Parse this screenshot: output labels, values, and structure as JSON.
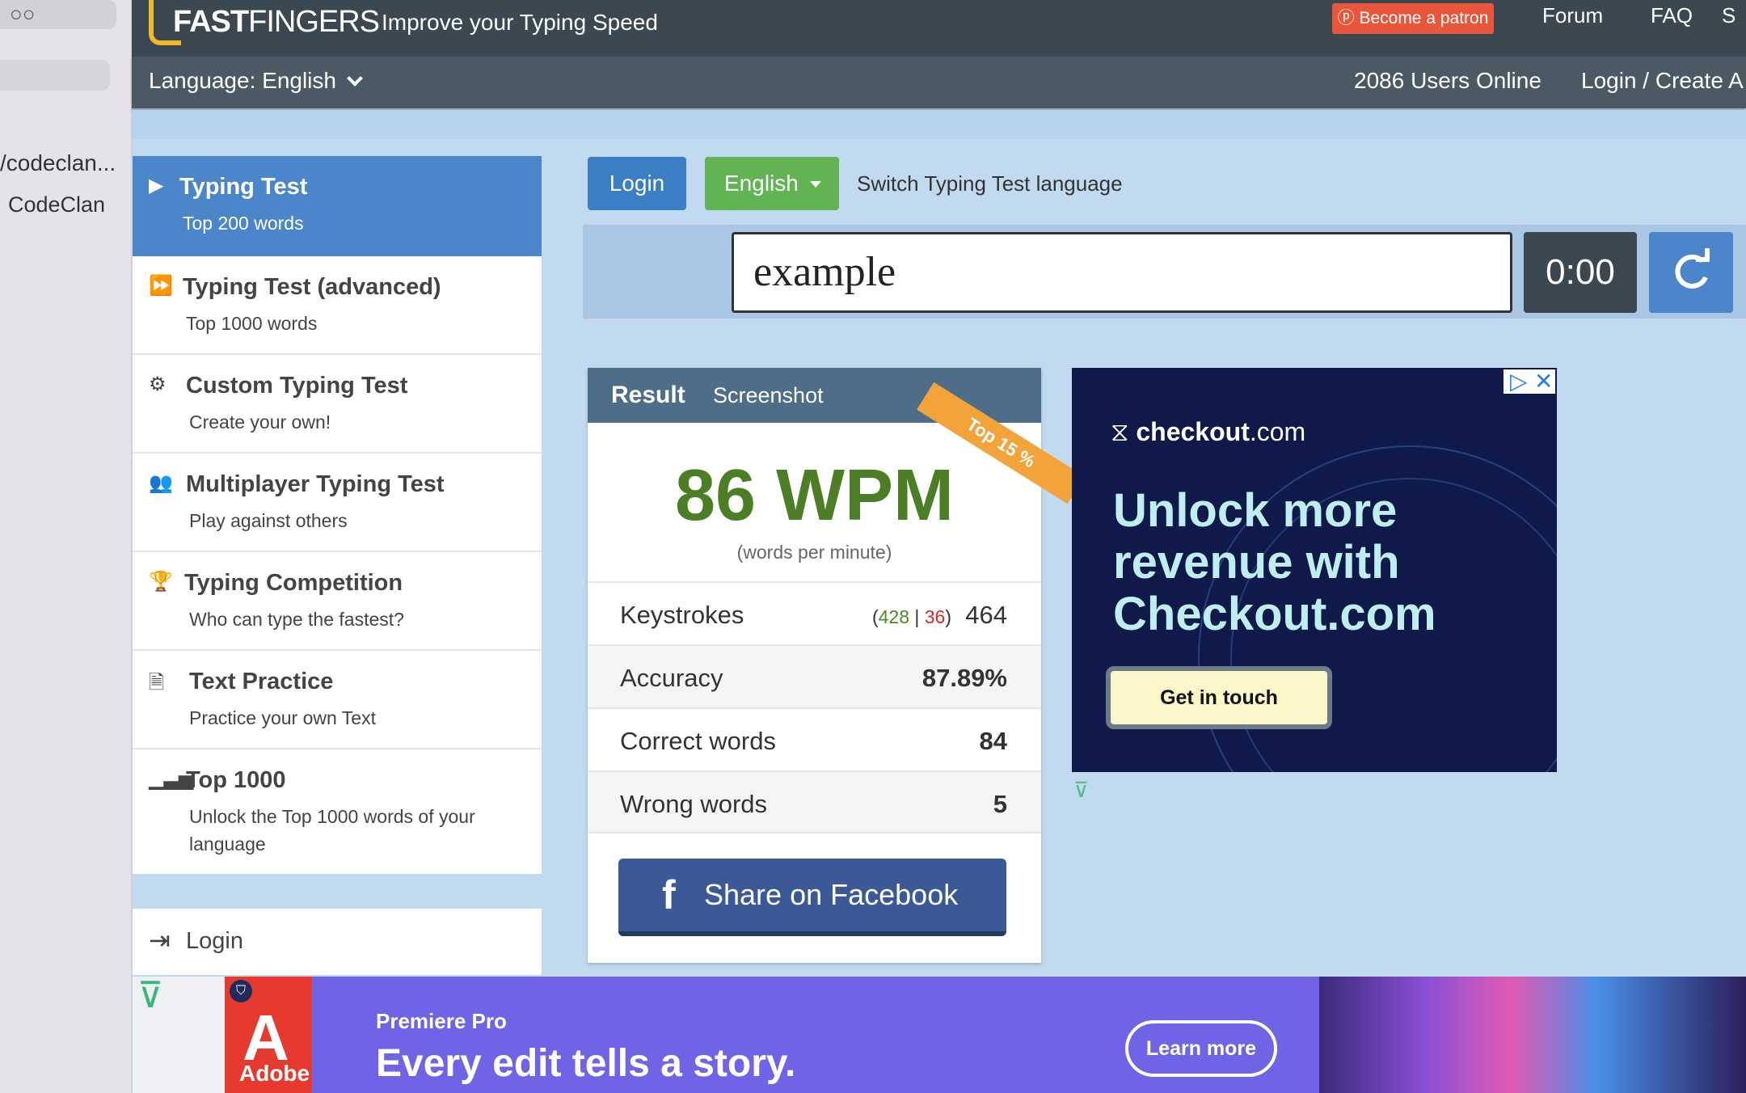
{
  "browser_sidebar": {
    "url_fragment": "/codeclan...",
    "tab_title": "CodeClan"
  },
  "header": {
    "logo_prefix": "FAST",
    "logo_suffix": "FINGERS",
    "tagline": "Improve your Typing Speed",
    "patron_label": "Become a patron",
    "nav": {
      "forum": "Forum",
      "faq": "FAQ",
      "cut": "S"
    }
  },
  "subbar": {
    "language_label": "Language: English",
    "users_online": "2086 Users Online",
    "login_create": "Login / Create A"
  },
  "menu": [
    {
      "title": "Typing Test",
      "sub": "Top 200 words",
      "icon": "play-icon"
    },
    {
      "title": "Typing Test (advanced)",
      "sub": "Top 1000 words",
      "icon": "fast-forward-icon"
    },
    {
      "title": "Custom Typing Test",
      "sub": "Create your own!",
      "icon": "gears-icon"
    },
    {
      "title": "Multiplayer Typing Test",
      "sub": "Play against others",
      "icon": "users-icon"
    },
    {
      "title": "Typing Competition",
      "sub": "Who can type the fastest?",
      "icon": "trophy-icon"
    },
    {
      "title": "Text Practice",
      "sub": "Practice your own Text",
      "icon": "document-icon"
    },
    {
      "title": "Top 1000",
      "sub": "Unlock the Top 1000 words of your language",
      "icon": "signal-bars-icon"
    }
  ],
  "side_login": "Login",
  "controls": {
    "login": "Login",
    "language": "English",
    "switch_text": "Switch Typing Test language"
  },
  "test": {
    "current_word": "example",
    "timer": "0:00"
  },
  "result": {
    "tab_result": "Result",
    "tab_screenshot": "Screenshot",
    "ribbon": "Top 15 %",
    "wpm": "86 WPM",
    "wpm_sub": "(words per minute)",
    "keystrokes_label": "Keystrokes",
    "keystrokes_correct": "428",
    "keystrokes_wrong": "36",
    "keystrokes_total": "464",
    "accuracy_label": "Accuracy",
    "accuracy": "87.89%",
    "correct_label": "Correct words",
    "correct": "84",
    "wrong_label": "Wrong words",
    "wrong": "5",
    "share": "Share on Facebook"
  },
  "ad_right": {
    "brand_bold": "checkout",
    "brand_rest": ".com",
    "headline": "Unlock more revenue with Checkout.com",
    "cta": "Get in touch"
  },
  "ad_bottom": {
    "brand": "Adobe",
    "product": "Premiere Pro",
    "tagline": "Every edit tells a story.",
    "cta": "Learn more"
  }
}
